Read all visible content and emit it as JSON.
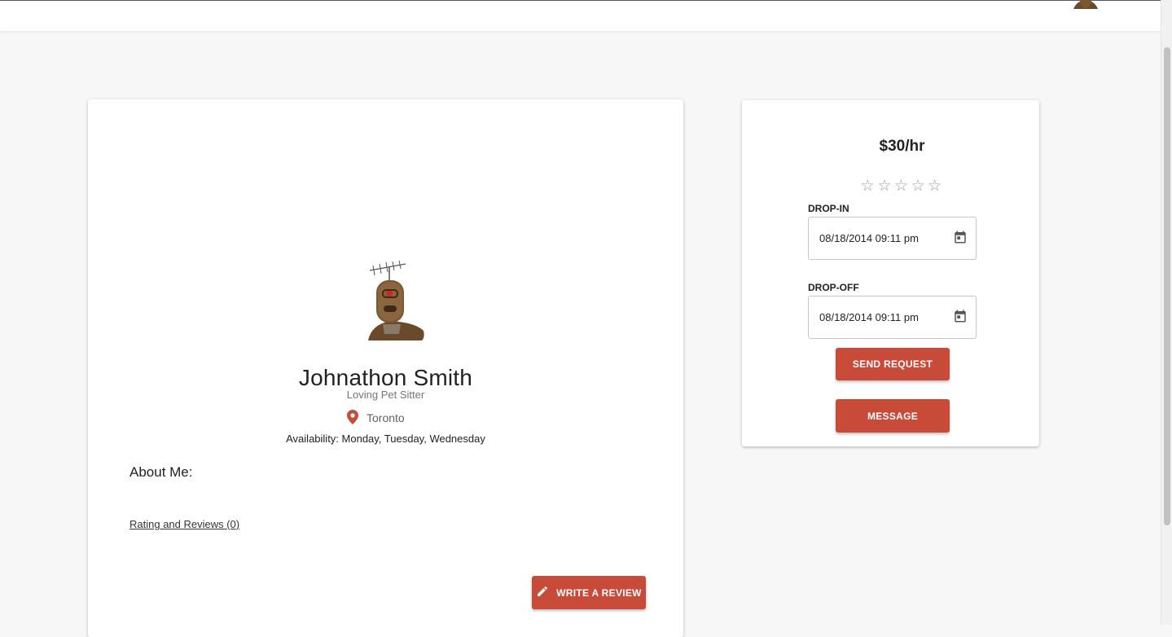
{
  "profile": {
    "name": "Johnathon Smith",
    "tagline": "Loving Pet Sitter",
    "location": "Toronto",
    "availability": "Availability: Monday, Tuesday, Wednesday",
    "about_label": "About Me:",
    "reviews_link": "Rating and Reviews (0)",
    "write_review_label": "WRITE A REVIEW"
  },
  "booking": {
    "price": "$30/hr",
    "rating": {
      "value": 0,
      "max": 5,
      "stars": [
        "☆",
        "☆",
        "☆",
        "☆",
        "☆"
      ]
    },
    "drop_in": {
      "label": "DROP-IN",
      "value": "08/18/2014 09:11 pm"
    },
    "drop_off": {
      "label": "DROP-OFF",
      "value": "08/18/2014 09:11 pm"
    },
    "send_request_label": "SEND REQUEST",
    "message_label": "MESSAGE"
  },
  "colors": {
    "accent": "#c84b39",
    "page_background": "#f7f7f7",
    "card_background": "#ffffff"
  },
  "icons": [
    "robot-avatar",
    "location-pin-icon",
    "calendar-icon",
    "pencil-icon",
    "star-outline-icon"
  ]
}
